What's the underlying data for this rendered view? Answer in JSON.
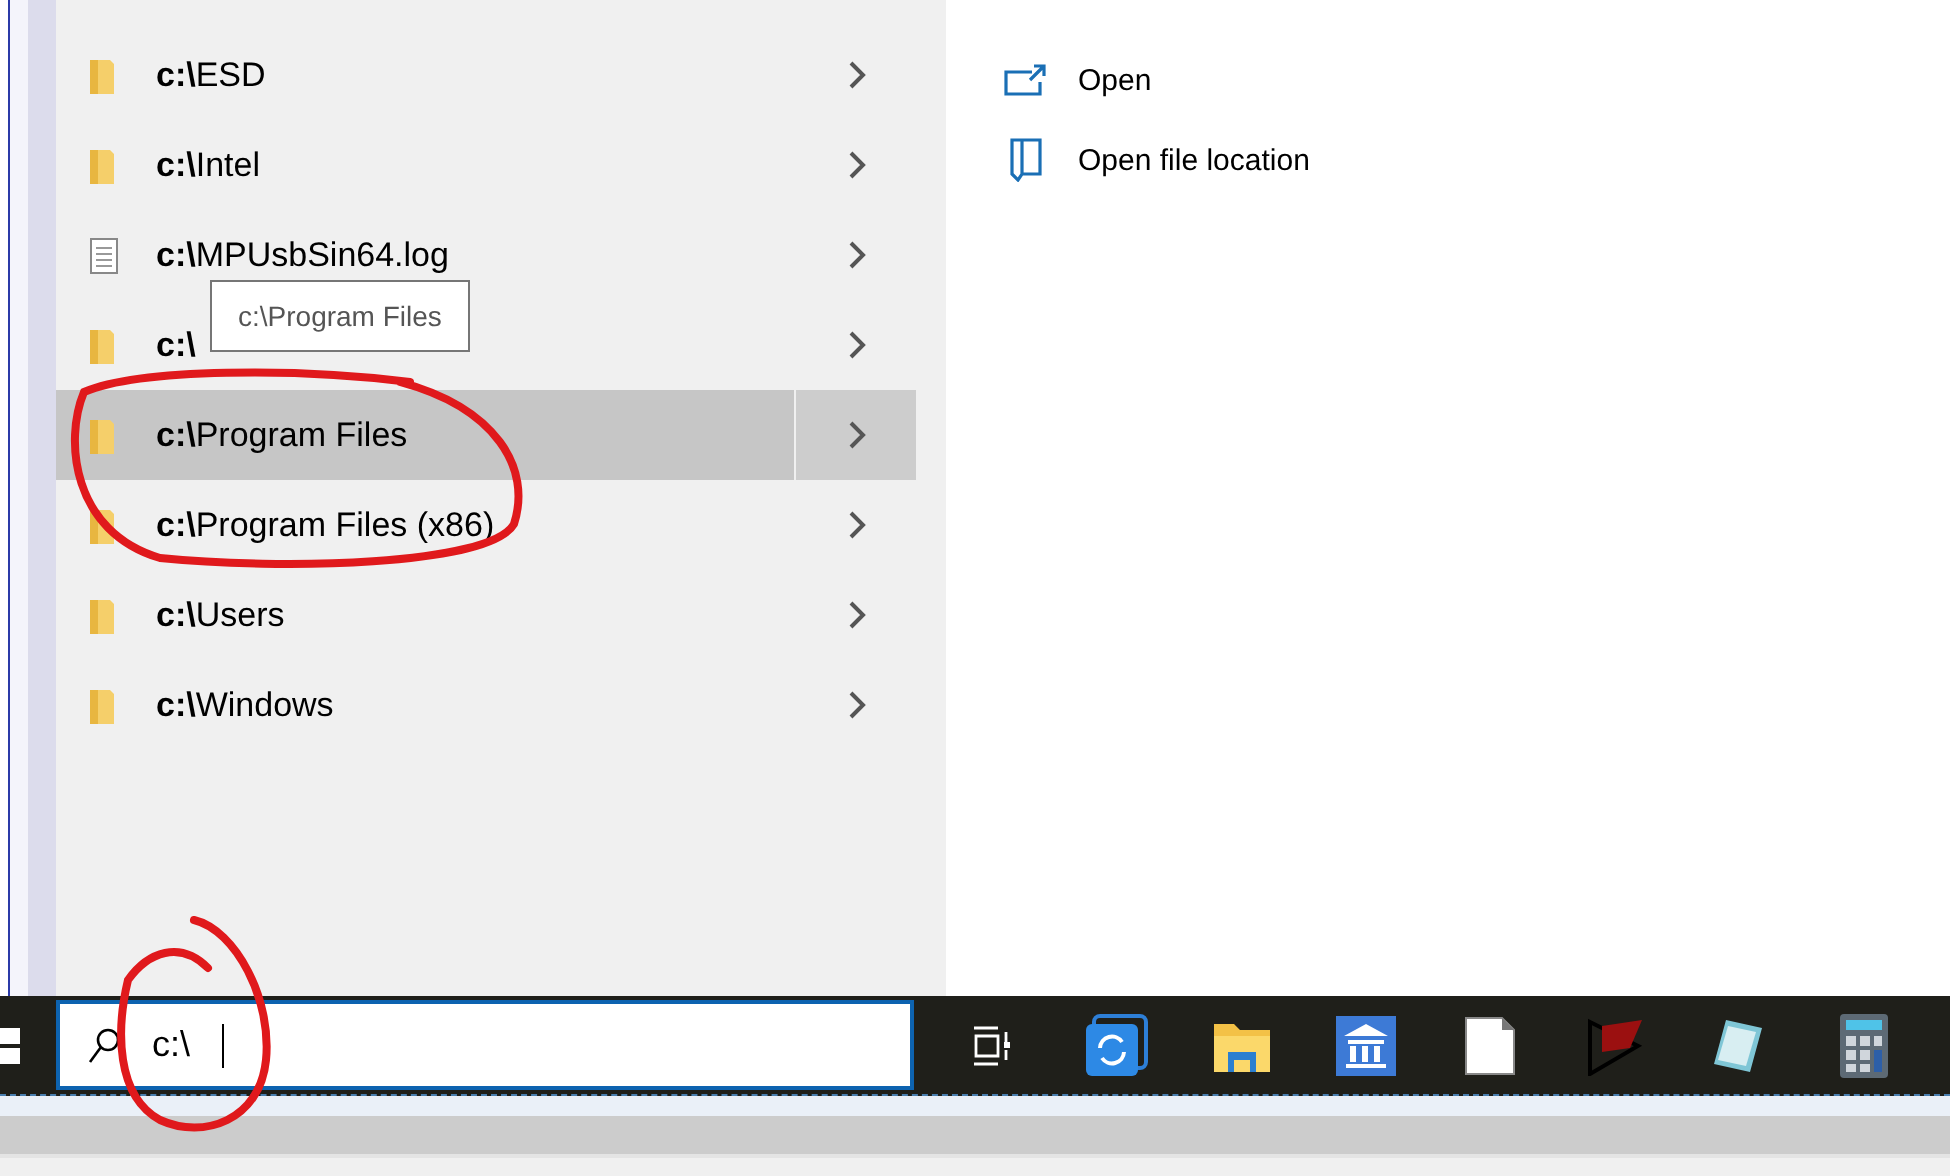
{
  "results": [
    {
      "kind": "folder",
      "label": "**c:\\**ESD",
      "selected": false
    },
    {
      "kind": "folder",
      "label": "**c:\\**Intel",
      "selected": false
    },
    {
      "kind": "file",
      "label": "**c:\\**MPUsbSin64.log",
      "selected": false
    },
    {
      "kind": "folder",
      "label": "**c:\\**",
      "selected": false
    },
    {
      "kind": "folder",
      "label": "**c:\\**Program Files",
      "selected": true
    },
    {
      "kind": "folder",
      "label": "**c:\\**Program Files (x86)",
      "selected": false
    },
    {
      "kind": "folder",
      "label": "**c:\\**Users",
      "selected": false
    },
    {
      "kind": "folder",
      "label": "**c:\\**Windows",
      "selected": false
    }
  ],
  "tooltip": {
    "text": "c:\\Program Files"
  },
  "actions": [
    {
      "kind": "open",
      "label": "Open"
    },
    {
      "kind": "location",
      "label": "Open file location"
    }
  ],
  "search": {
    "value": "c:\\"
  },
  "taskbar": [
    {
      "kind": "taskview"
    },
    {
      "kind": "sync"
    },
    {
      "kind": "explorer"
    },
    {
      "kind": "bank"
    },
    {
      "kind": "document"
    },
    {
      "kind": "flag"
    },
    {
      "kind": "notepad"
    },
    {
      "kind": "calculator"
    }
  ]
}
